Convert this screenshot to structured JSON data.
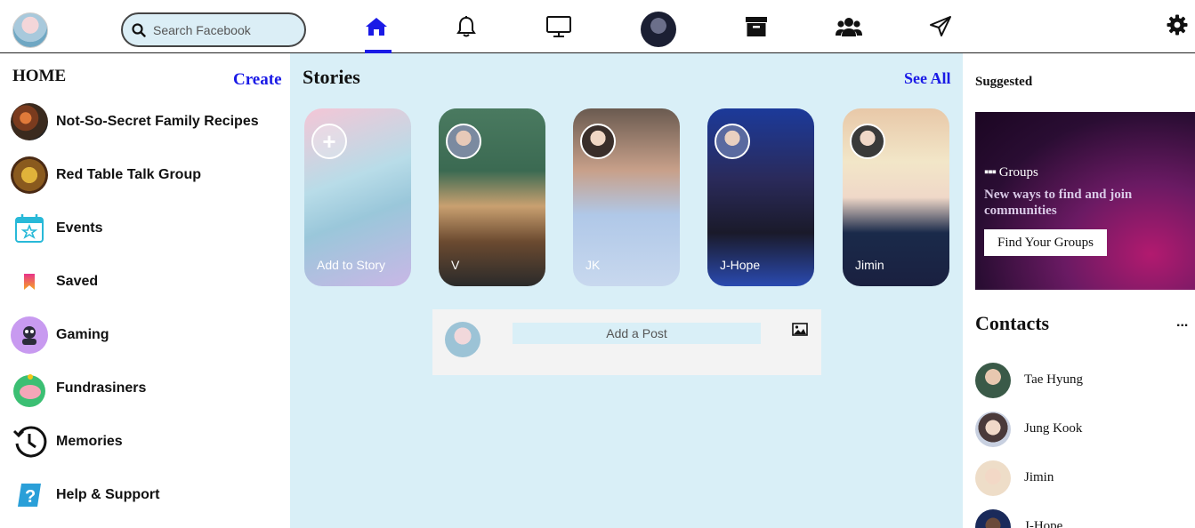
{
  "search": {
    "placeholder": "Search Facebook"
  },
  "nav": {
    "icons": [
      "home-icon",
      "bell-icon",
      "monitor-icon",
      "profile-avatar",
      "archive-icon",
      "users-icon",
      "paper-plane-icon",
      "gear-icon"
    ],
    "accent": "#1a1ae6"
  },
  "sidebar": {
    "title": "HOME",
    "create_label": "Create",
    "items": [
      {
        "label": "Not-So-Secret Family Recipes",
        "icon": "recipes-group-avatar"
      },
      {
        "label": "Red Table Talk Group",
        "icon": "red-table-group-avatar"
      },
      {
        "label": "Events",
        "icon": "calendar-icon"
      },
      {
        "label": "Saved",
        "icon": "bookmark-icon"
      },
      {
        "label": "Gaming",
        "icon": "gaming-icon"
      },
      {
        "label": "Fundrasiners",
        "icon": "piggy-bank-icon"
      },
      {
        "label": "Memories",
        "icon": "clock-history-icon"
      },
      {
        "label": "Help & Support",
        "icon": "help-icon"
      }
    ]
  },
  "stories": {
    "title": "Stories",
    "see_all": "See All",
    "items": [
      {
        "name": "Add to Story"
      },
      {
        "name": "V"
      },
      {
        "name": "JK"
      },
      {
        "name": "J-Hope"
      },
      {
        "name": "Jimin"
      }
    ]
  },
  "composer": {
    "placeholder": "Add a Post"
  },
  "suggested": {
    "title": "Suggested",
    "groups_label": "Groups",
    "groups_desc": "New ways to find and join communities",
    "groups_button": "Find Your Groups"
  },
  "contacts": {
    "title": "Contacts",
    "more": "...",
    "items": [
      "Tae Hyung",
      "Jung Kook",
      "Jimin",
      "J-Hope"
    ]
  },
  "colors": {
    "page_bg": "#d9eff7",
    "link": "#1a1ae6"
  }
}
